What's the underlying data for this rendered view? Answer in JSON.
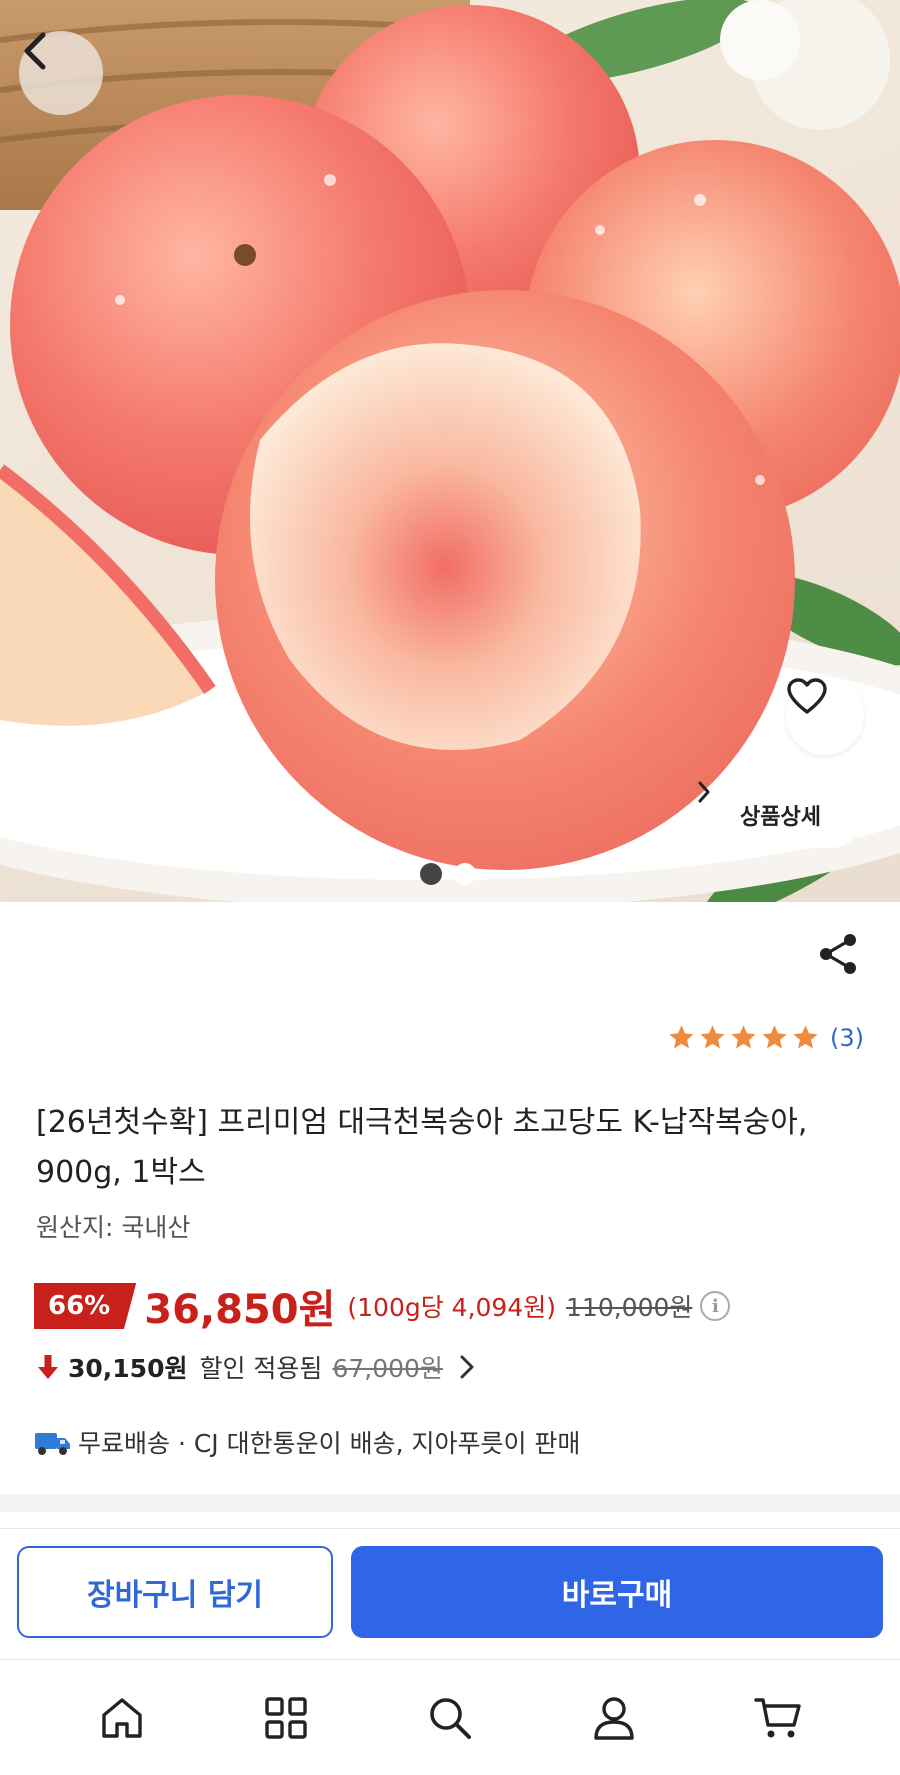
{
  "hero": {
    "slide_index": 1,
    "slide_count": 2,
    "detail_label": "상품상세"
  },
  "product": {
    "rating_stars": 5,
    "review_count": "(3)",
    "title": "[26년첫수확] 프리미엄 대극천복숭아 초고당도 K-납작복숭아, 900g, 1박스",
    "origin": "원산지: 국내산"
  },
  "price": {
    "discount_pct": "66%",
    "sale_price": "36,850원",
    "unit_price": "(100g당 4,094원)",
    "original_price": "110,000원"
  },
  "coupon": {
    "applied_price": "30,150원",
    "applied_label": "할인 적용됨",
    "before_price": "67,000원"
  },
  "shipping": {
    "text": "무료배송 · CJ 대한통운이 배송, 지아푸릇이 판매"
  },
  "actions": {
    "cart_label": "장바구니 담기",
    "buy_label": "바로구매"
  },
  "nav": [
    "home-icon",
    "category-icon",
    "search-icon",
    "profile-icon",
    "cart-icon"
  ],
  "colors": {
    "sale_red": "#c8201a",
    "accent_blue": "#2f66e8",
    "star_orange": "#f08a3c"
  }
}
